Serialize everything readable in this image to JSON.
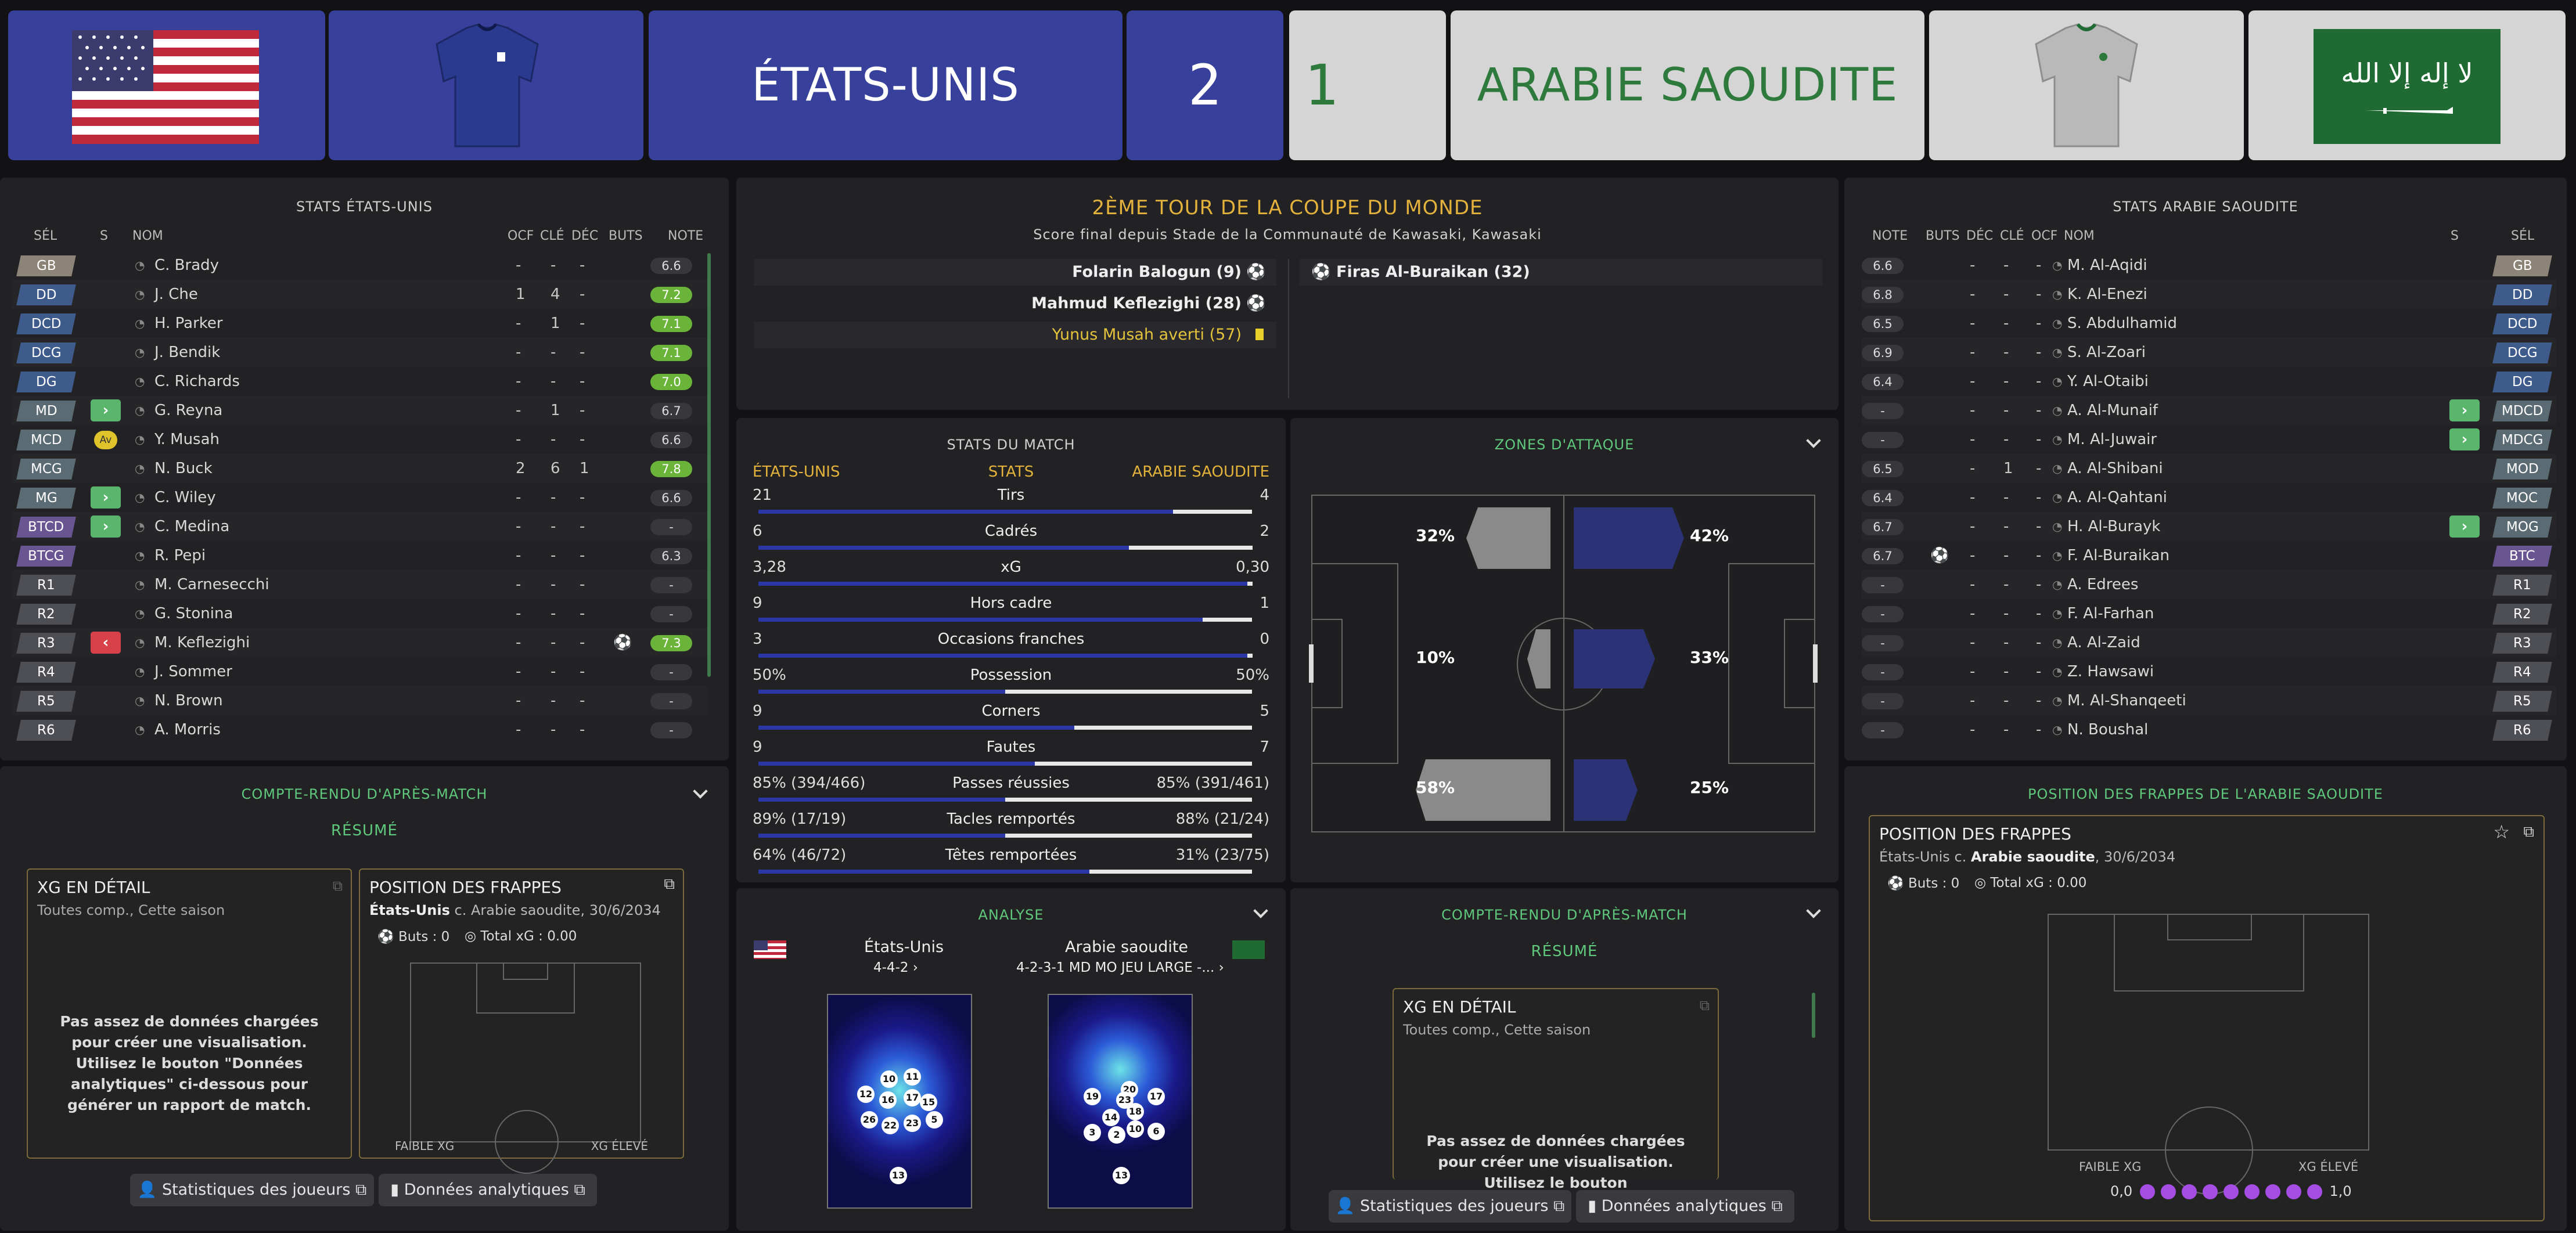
{
  "colors": {
    "home": "#37409a",
    "away": "#d5d5d5",
    "accent_green": "#5fc87d",
    "accent_gold": "#e3b23c"
  },
  "header": {
    "home_name": "ÉTATS-UNIS",
    "home_score": "2",
    "away_score": "1",
    "away_name": "ARABIE SAOUDITE",
    "home_flag_icon": "usa-flag-icon",
    "away_flag_icon": "saudi-flag-icon",
    "home_kit_icon": "blue-shirt-icon",
    "away_kit_icon": "white-shirt-icon"
  },
  "home_stats": {
    "title": "STATS ÉTATS-UNIS",
    "columns": [
      "SÉL",
      "S",
      "NOM",
      "OCF",
      "CLÉ",
      "DÉC",
      "BUTS",
      "NOTE"
    ],
    "players": [
      {
        "pos": "GB",
        "name": "C. Brady",
        "ocf": "-",
        "cle": "-",
        "dec": "-",
        "buts": "",
        "note": "6.6",
        "good": false,
        "cat": "GB"
      },
      {
        "pos": "DD",
        "name": "J. Che",
        "ocf": "1",
        "cle": "4",
        "dec": "-",
        "buts": "",
        "note": "7.2",
        "good": true,
        "cat": "DEF"
      },
      {
        "pos": "DCD",
        "name": "H. Parker",
        "ocf": "-",
        "cle": "1",
        "dec": "-",
        "buts": "",
        "note": "7.1",
        "good": true,
        "cat": "DEF"
      },
      {
        "pos": "DCG",
        "name": "J. Bendik",
        "ocf": "-",
        "cle": "-",
        "dec": "-",
        "buts": "",
        "note": "7.1",
        "good": true,
        "cat": "DEF"
      },
      {
        "pos": "DG",
        "name": "C. Richards",
        "ocf": "-",
        "cle": "-",
        "dec": "-",
        "buts": "",
        "note": "7.0",
        "good": true,
        "cat": "DEF"
      },
      {
        "pos": "MD",
        "name": "G. Reyna",
        "ocf": "-",
        "cle": "1",
        "dec": "-",
        "buts": "",
        "note": "6.7",
        "good": false,
        "cat": "MID",
        "sub": "in"
      },
      {
        "pos": "MCD",
        "name": "Y. Musah",
        "ocf": "-",
        "cle": "-",
        "dec": "-",
        "buts": "",
        "note": "6.6",
        "good": false,
        "cat": "MID",
        "sub": "av"
      },
      {
        "pos": "MCG",
        "name": "N. Buck",
        "ocf": "2",
        "cle": "6",
        "dec": "1",
        "buts": "",
        "note": "7.8",
        "good": true,
        "cat": "MID"
      },
      {
        "pos": "MG",
        "name": "C. Wiley",
        "ocf": "-",
        "cle": "-",
        "dec": "-",
        "buts": "",
        "note": "6.6",
        "good": false,
        "cat": "MID",
        "sub": "in"
      },
      {
        "pos": "BTCD",
        "name": "C. Medina",
        "ocf": "-",
        "cle": "-",
        "dec": "-",
        "buts": "",
        "note": "-",
        "good": false,
        "cat": "ATT",
        "sub": "in"
      },
      {
        "pos": "BTCG",
        "name": "R. Pepi",
        "ocf": "-",
        "cle": "-",
        "dec": "-",
        "buts": "",
        "note": "6.3",
        "good": false,
        "cat": "ATT"
      },
      {
        "pos": "R1",
        "name": "M. Carnesecchi",
        "ocf": "-",
        "cle": "-",
        "dec": "-",
        "buts": "",
        "note": "-",
        "good": false,
        "cat": "RES"
      },
      {
        "pos": "R2",
        "name": "G. Stonina",
        "ocf": "-",
        "cle": "-",
        "dec": "-",
        "buts": "",
        "note": "-",
        "good": false,
        "cat": "RES"
      },
      {
        "pos": "R3",
        "name": "M. Keflezighi",
        "ocf": "-",
        "cle": "-",
        "dec": "-",
        "buts": "⚽",
        "note": "7.3",
        "good": true,
        "cat": "RES",
        "sub": "out"
      },
      {
        "pos": "R4",
        "name": "J. Sommer",
        "ocf": "-",
        "cle": "-",
        "dec": "-",
        "buts": "",
        "note": "-",
        "good": false,
        "cat": "RES"
      },
      {
        "pos": "R5",
        "name": "N. Brown",
        "ocf": "-",
        "cle": "-",
        "dec": "-",
        "buts": "",
        "note": "-",
        "good": false,
        "cat": "RES"
      },
      {
        "pos": "R6",
        "name": "A. Morris",
        "ocf": "-",
        "cle": "-",
        "dec": "-",
        "buts": "",
        "note": "-",
        "good": false,
        "cat": "RES"
      }
    ]
  },
  "match_info": {
    "competition": "2ÈME TOUR DE LA COUPE DU MONDE",
    "subtitle": "Score final depuis Stade de la Communauté de Kawasaki, Kawasaki",
    "home_events": [
      "Folarin Balogun (9)",
      "Mahmud Keflezighi (28)",
      "Yunus Musah averti (57)"
    ],
    "away_events": [
      "Firas Al-Buraikan (32)"
    ]
  },
  "match_stats": {
    "title": "STATS DU MATCH",
    "home_label": "ÉTATS-UNIS",
    "mid_label": "STATS",
    "away_label": "ARABIE SAOUDITE",
    "rows": [
      {
        "label": "Tirs",
        "home": "21",
        "away": "4",
        "hf": 0.84
      },
      {
        "label": "Cadrés",
        "home": "6",
        "away": "2",
        "hf": 0.75
      },
      {
        "label": "xG",
        "home": "3,28",
        "away": "0,30",
        "hf": 0.99
      },
      {
        "label": "Hors cadre",
        "home": "9",
        "away": "1",
        "hf": 0.9
      },
      {
        "label": "Occasions franches",
        "home": "3",
        "away": "0",
        "hf": 0.99
      },
      {
        "label": "Possession",
        "home": "50%",
        "away": "50%",
        "hf": 0.5
      },
      {
        "label": "Corners",
        "home": "9",
        "away": "5",
        "hf": 0.64
      },
      {
        "label": "Fautes",
        "home": "9",
        "away": "7",
        "hf": 0.56
      },
      {
        "label": "Passes réussies",
        "home": "85% (394/466)",
        "away": "85% (391/461)",
        "hf": 0.5
      },
      {
        "label": "Tacles remportés",
        "home": "89% (17/19)",
        "away": "88% (21/24)",
        "hf": 0.5
      },
      {
        "label": "Têtes remportées",
        "home": "64% (46/72)",
        "away": "31% (23/75)",
        "hf": 0.67
      }
    ]
  },
  "attack_zones": {
    "title": "ZONES D'ATTAQUE",
    "away_left": "32%",
    "away_center": "10%",
    "away_right": "58%",
    "home_left": "42%",
    "home_center": "33%",
    "home_right": "25%"
  },
  "away_stats": {
    "title": "STATS ARABIE SAOUDITE",
    "columns": [
      "NOTE",
      "BUTS",
      "DÉC",
      "CLÉ",
      "OCF",
      "NOM",
      "S",
      "SÉL"
    ],
    "players": [
      {
        "pos": "GB",
        "name": "M. Al-Aqidi",
        "note": "6.6",
        "buts": "",
        "cat": "GB"
      },
      {
        "pos": "DD",
        "name": "K. Al-Enezi",
        "note": "6.8",
        "buts": "",
        "cat": "DEF"
      },
      {
        "pos": "DCD",
        "name": "S. Abdulhamid",
        "note": "6.5",
        "buts": "",
        "cat": "DEF"
      },
      {
        "pos": "DCG",
        "name": "S. Al-Zoari",
        "note": "6.9",
        "buts": "",
        "cat": "DEF"
      },
      {
        "pos": "DG",
        "name": "Y. Al-Otaibi",
        "note": "6.4",
        "buts": "",
        "cat": "DEF"
      },
      {
        "pos": "MDCD",
        "name": "A. Al-Munaif",
        "note": "-",
        "buts": "",
        "cat": "MID",
        "sub": "in"
      },
      {
        "pos": "MDCG",
        "name": "M. Al-Juwair",
        "note": "-",
        "buts": "",
        "cat": "MID",
        "sub": "in"
      },
      {
        "pos": "MOD",
        "name": "A. Al-Shibani",
        "note": "6.5",
        "buts": "",
        "cat": "MID",
        "cle": "1"
      },
      {
        "pos": "MOC",
        "name": "A. Al-Qahtani",
        "note": "6.4",
        "buts": "",
        "cat": "MID"
      },
      {
        "pos": "MOG",
        "name": "H. Al-Burayk",
        "note": "6.7",
        "buts": "",
        "cat": "MID",
        "sub": "in"
      },
      {
        "pos": "BTC",
        "name": "F. Al-Buraikan",
        "note": "6.7",
        "buts": "⚽",
        "cat": "ATT"
      },
      {
        "pos": "R1",
        "name": "A. Edrees",
        "note": "-",
        "buts": "",
        "cat": "RES"
      },
      {
        "pos": "R2",
        "name": "F. Al-Farhan",
        "note": "-",
        "buts": "",
        "cat": "RES"
      },
      {
        "pos": "R3",
        "name": "A. Al-Zaid",
        "note": "-",
        "buts": "",
        "cat": "RES"
      },
      {
        "pos": "R4",
        "name": "Z. Hawsawi",
        "note": "-",
        "buts": "",
        "cat": "RES"
      },
      {
        "pos": "R5",
        "name": "M. Al-Shanqeeti",
        "note": "-",
        "buts": "",
        "cat": "RES"
      },
      {
        "pos": "R6",
        "name": "N. Boushal",
        "note": "-",
        "buts": "",
        "cat": "RES"
      }
    ]
  },
  "left_report": {
    "title": "COMPTE-RENDU D'APRÈS-MATCH",
    "tab": "RÉSUMÉ",
    "xg_title": "XG EN DÉTAIL",
    "xg_sub": "Toutes comp., Cette saison",
    "xg_msg": "Pas assez de données chargées pour créer une visualisation. Utilisez le bouton \"Données analytiques\" ci-dessous pour générer un rapport de match.",
    "shots_title": "POSITION DES FRAPPES",
    "shots_team": "États-Unis",
    "shots_rest": "c. Arabie saoudite, 30/6/2034",
    "buts": "Buts : 0",
    "total_xg": "Total xG : 0.00",
    "low": "FAIBLE XG",
    "high": "XG ÉLEVÉ",
    "btn_players": "Statistiques des joueurs",
    "btn_data": "Données analytiques"
  },
  "analysis": {
    "title": "ANALYSE",
    "home_team": "États-Unis",
    "home_form": "4-4-2",
    "away_team": "Arabie saoudite",
    "away_form": "4-2-3-1 MD MO JEU LARGE -...",
    "home_numbers": [
      "10",
      "11",
      "12",
      "16",
      "17",
      "15",
      "26",
      "22",
      "23",
      "5",
      "13"
    ],
    "away_numbers": [
      "19",
      "20",
      "23",
      "17",
      "14",
      "18",
      "3",
      "2",
      "10",
      "6",
      "13"
    ]
  },
  "mid_report": {
    "title": "COMPTE-RENDU D'APRÈS-MATCH",
    "tab": "RÉSUMÉ",
    "xg_title": "XG EN DÉTAIL",
    "xg_sub": "Toutes comp., Cette saison",
    "xg_msg": "Pas assez de données chargées pour créer une visualisation. Utilisez le bouton",
    "btn_players": "Statistiques des joueurs",
    "btn_data": "Données analytiques"
  },
  "right_shots": {
    "title": "POSITION DES FRAPPES DE L'ARABIE SAOUDITE",
    "box_title": "POSITION DES FRAPPES",
    "team": "États-Unis",
    "sep": "c.",
    "team2": "Arabie saoudite",
    "date": ", 30/6/2034",
    "buts": "Buts : 0",
    "total_xg": "Total xG : 0.00",
    "low": "FAIBLE XG",
    "high": "XG ÉLEVÉ",
    "scale_min": "0,0",
    "scale_max": "1,0"
  }
}
